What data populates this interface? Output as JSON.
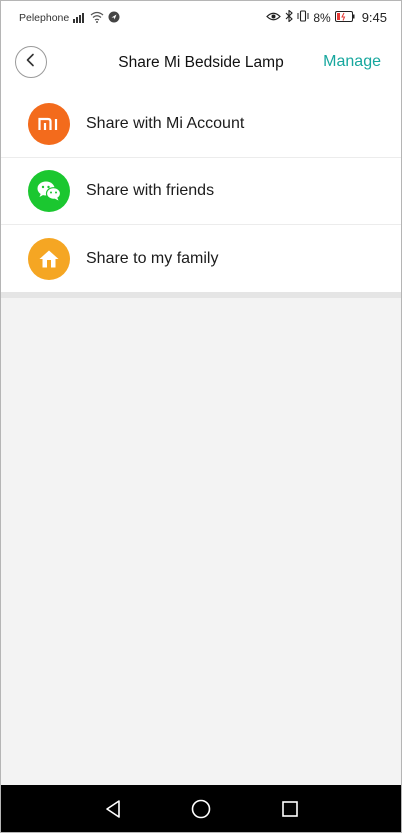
{
  "status_bar": {
    "carrier": "Pelephone",
    "battery_percent": "8%",
    "time": "9:45",
    "icons": [
      "signal-icon",
      "wifi-icon",
      "location-icon",
      "eye-icon",
      "bluetooth-icon",
      "vibrate-icon",
      "battery-icon"
    ]
  },
  "header": {
    "title": "Share Mi Bedside Lamp",
    "manage_label": "Manage",
    "back_icon": "back-icon"
  },
  "share_options": [
    {
      "label": "Share with Mi Account",
      "icon": "mi-logo-icon",
      "color": "#f36b1c"
    },
    {
      "label": "Share with friends",
      "icon": "wechat-icon",
      "color": "#1bc730"
    },
    {
      "label": "Share to my family",
      "icon": "home-icon",
      "color": "#f5a623"
    }
  ],
  "colors": {
    "accent": "#17a79e",
    "background": "#f3f3f3"
  },
  "nav_bar": {
    "icons": [
      "back-triangle-icon",
      "home-circle-icon",
      "recents-square-icon"
    ]
  }
}
